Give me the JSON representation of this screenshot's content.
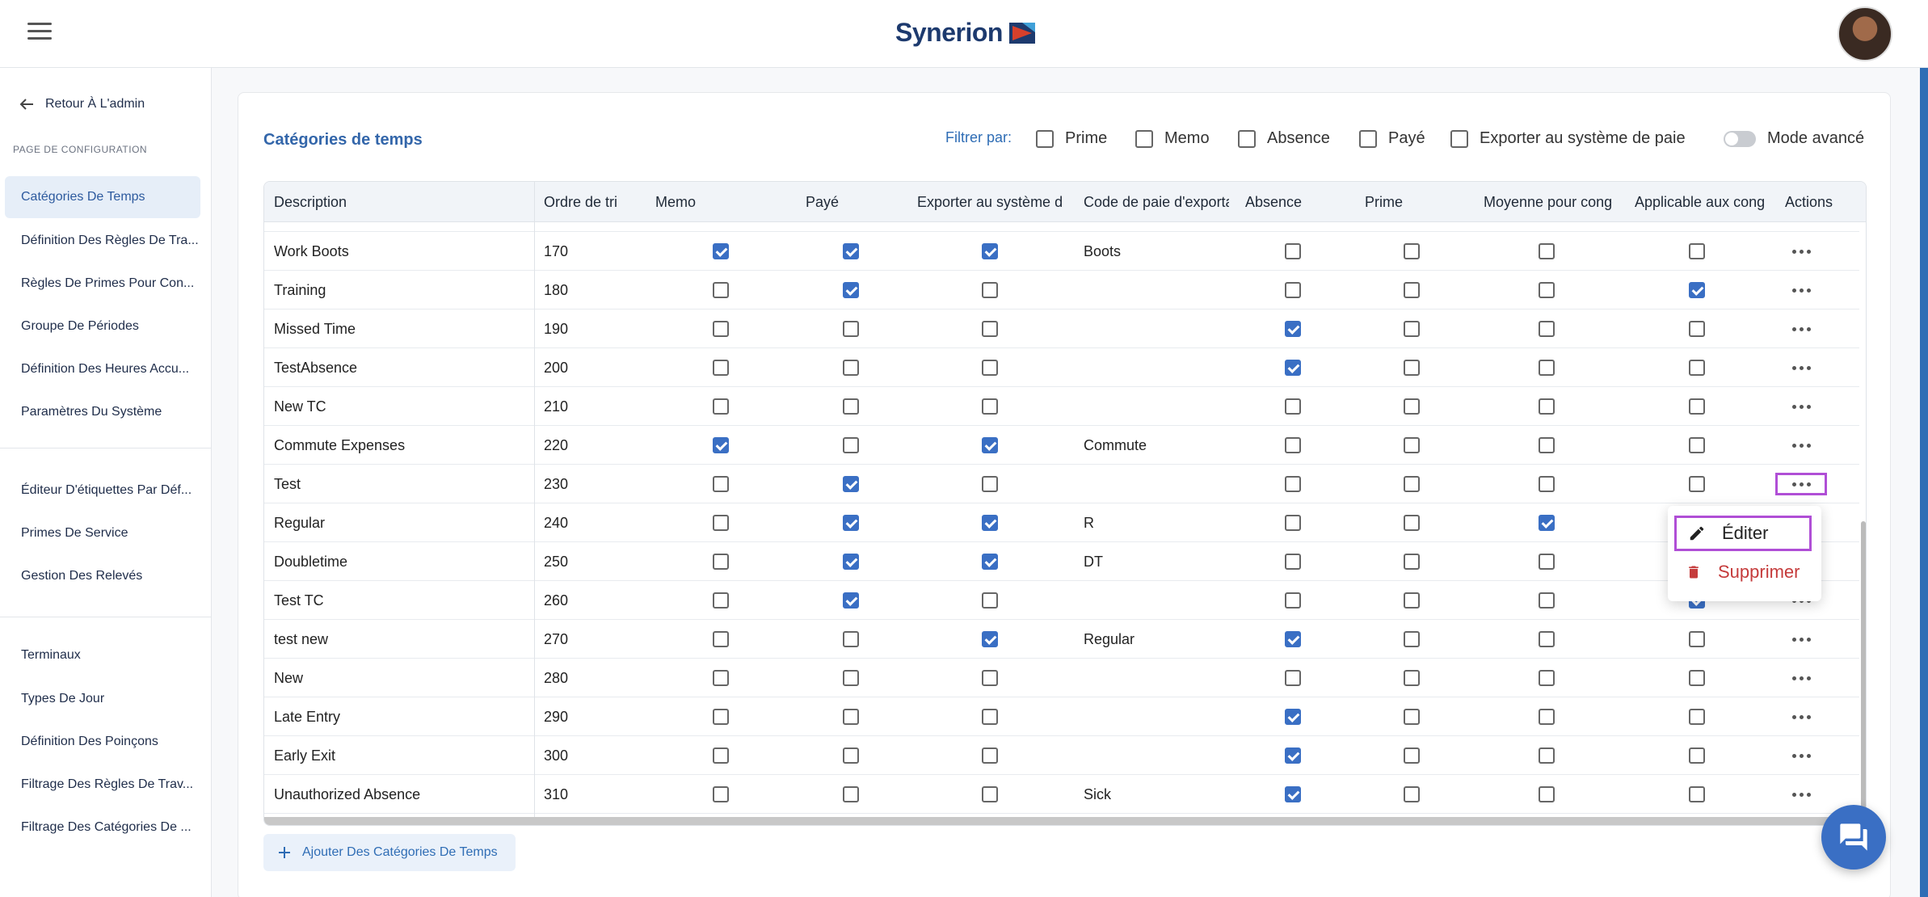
{
  "app": {
    "logo_text": "Synerion"
  },
  "sidebar": {
    "back_label": "Retour À L'admin",
    "section_label": "PAGE DE CONFIGURATION",
    "items": [
      {
        "label": "Catégories De Temps"
      },
      {
        "label": "Définition Des Règles De Tra..."
      },
      {
        "label": "Règles De Primes Pour Con..."
      },
      {
        "label": "Groupe De Périodes"
      },
      {
        "label": "Définition Des Heures Accu..."
      },
      {
        "label": "Paramètres Du Système"
      },
      {
        "label": "Éditeur D'étiquettes Par Déf..."
      },
      {
        "label": "Primes De Service"
      },
      {
        "label": "Gestion Des Relevés"
      },
      {
        "label": "Terminaux"
      },
      {
        "label": "Types De Jour"
      },
      {
        "label": "Définition Des Poinçons"
      },
      {
        "label": "Filtrage Des Règles De Trav..."
      },
      {
        "label": "Filtrage Des Catégories De ..."
      }
    ]
  },
  "main": {
    "title": "Catégories de temps",
    "filter_label": "Filtrer par:",
    "filters": [
      "Prime",
      "Memo",
      "Absence",
      "Payé",
      "Exporter au système de paie"
    ],
    "advanced_mode_label": "Mode avancé",
    "add_button_label": "Ajouter Des Catégories De Temps"
  },
  "table": {
    "columns": [
      "Description",
      "Ordre de tri",
      "Memo",
      "Payé",
      "Exporter au système de paie",
      "Code de paie d'exportation",
      "Absence",
      "Prime",
      "Moyenne pour congé",
      "Applicable aux congés",
      "Actions"
    ],
    "rows": [
      {
        "description": "Work Boots",
        "order": "170",
        "memo": true,
        "paye": true,
        "export": true,
        "code": "Boots",
        "absence": false,
        "prime": false,
        "moyenne": false,
        "applicable": false
      },
      {
        "description": "Training",
        "order": "180",
        "memo": false,
        "paye": true,
        "export": false,
        "code": "",
        "absence": false,
        "prime": false,
        "moyenne": false,
        "applicable": true
      },
      {
        "description": "Missed Time",
        "order": "190",
        "memo": false,
        "paye": false,
        "export": false,
        "code": "",
        "absence": true,
        "prime": false,
        "moyenne": false,
        "applicable": false
      },
      {
        "description": "TestAbsence",
        "order": "200",
        "memo": false,
        "paye": false,
        "export": false,
        "code": "",
        "absence": true,
        "prime": false,
        "moyenne": false,
        "applicable": false
      },
      {
        "description": "New TC",
        "order": "210",
        "memo": false,
        "paye": false,
        "export": false,
        "code": "",
        "absence": false,
        "prime": false,
        "moyenne": false,
        "applicable": false
      },
      {
        "description": "Commute Expenses",
        "order": "220",
        "memo": true,
        "paye": false,
        "export": true,
        "code": "Commute",
        "absence": false,
        "prime": false,
        "moyenne": false,
        "applicable": false
      },
      {
        "description": "Test",
        "order": "230",
        "memo": false,
        "paye": true,
        "export": false,
        "code": "",
        "absence": false,
        "prime": false,
        "moyenne": false,
        "applicable": false
      },
      {
        "description": "Regular",
        "order": "240",
        "memo": false,
        "paye": true,
        "export": true,
        "code": "R",
        "absence": false,
        "prime": false,
        "moyenne": true,
        "applicable": false
      },
      {
        "description": "Doubletime",
        "order": "250",
        "memo": false,
        "paye": true,
        "export": true,
        "code": "DT",
        "absence": false,
        "prime": false,
        "moyenne": false,
        "applicable": false
      },
      {
        "description": "Test TC",
        "order": "260",
        "memo": false,
        "paye": true,
        "export": false,
        "code": "",
        "absence": false,
        "prime": false,
        "moyenne": false,
        "applicable": true
      },
      {
        "description": "test new",
        "order": "270",
        "memo": false,
        "paye": false,
        "export": true,
        "code": "Regular",
        "absence": true,
        "prime": false,
        "moyenne": false,
        "applicable": false
      },
      {
        "description": "New",
        "order": "280",
        "memo": false,
        "paye": false,
        "export": false,
        "code": "",
        "absence": false,
        "prime": false,
        "moyenne": false,
        "applicable": false
      },
      {
        "description": "Late Entry",
        "order": "290",
        "memo": false,
        "paye": false,
        "export": false,
        "code": "",
        "absence": true,
        "prime": false,
        "moyenne": false,
        "applicable": false
      },
      {
        "description": "Early Exit",
        "order": "300",
        "memo": false,
        "paye": false,
        "export": false,
        "code": "",
        "absence": true,
        "prime": false,
        "moyenne": false,
        "applicable": false
      },
      {
        "description": "Unauthorized Absence",
        "order": "310",
        "memo": false,
        "paye": false,
        "export": false,
        "code": "Sick",
        "absence": true,
        "prime": false,
        "moyenne": false,
        "applicable": false
      }
    ]
  },
  "context_menu": {
    "edit_label": "Éditer",
    "delete_label": "Supprimer"
  },
  "colors": {
    "accent": "#3a6fc4",
    "highlight": "#b04fd6",
    "danger": "#c53b3b"
  }
}
